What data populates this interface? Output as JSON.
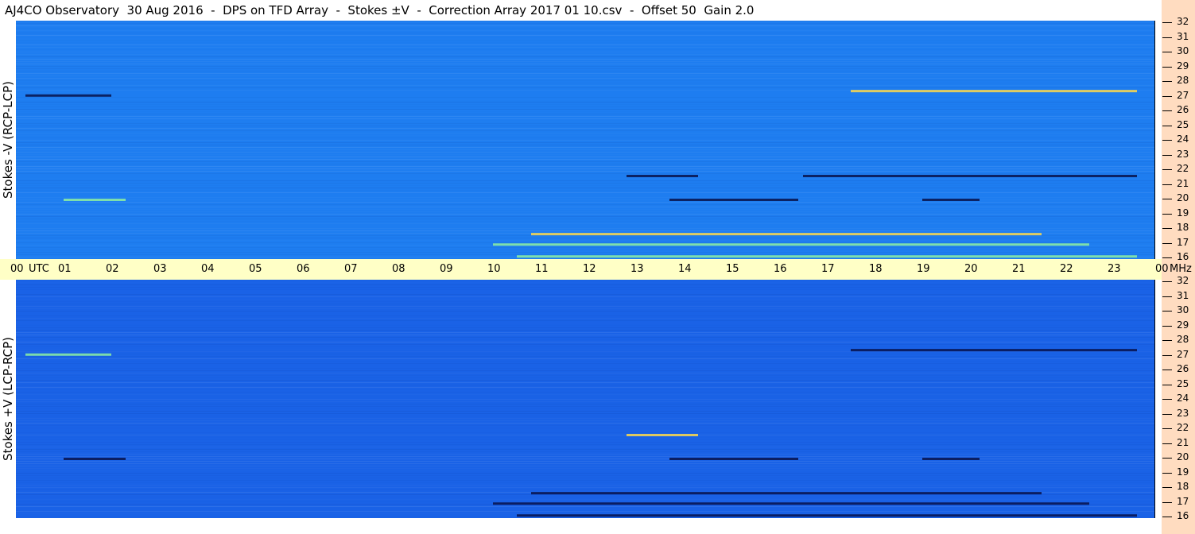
{
  "title": "AJ4CO Observatory  30 Aug 2016  -  DPS on TFD Array  -  Stokes ±V  -  Correction Array 2017 01 10.csv  -  Offset 50  Gain 2.0",
  "colors": {
    "top_background": "#1e7df0",
    "bottom_background": "#1a62e6",
    "axis_band": "#ffffc6",
    "freq_strip": "#ffdcc0",
    "hot": "#ffd94a",
    "warm": "#8ef0a0",
    "cold": "#08124a"
  },
  "chart_data": {
    "type": "heatmap",
    "x_unit": "UTC",
    "y_unit": "MHz",
    "x_ticks": [
      "00",
      "01",
      "02",
      "03",
      "04",
      "05",
      "06",
      "07",
      "08",
      "09",
      "10",
      "11",
      "12",
      "13",
      "14",
      "15",
      "16",
      "17",
      "18",
      "19",
      "20",
      "21",
      "22",
      "23",
      "00"
    ],
    "y_ticks": [
      "32",
      "31",
      "30",
      "29",
      "28",
      "27",
      "26",
      "25",
      "24",
      "23",
      "22",
      "21",
      "20",
      "19",
      "18",
      "17",
      "16"
    ],
    "xlim": [
      0,
      24
    ],
    "ylim": [
      16,
      32
    ],
    "panels": [
      {
        "label": "Stokes -V (RCP-LCP)",
        "features": [
          {
            "freq": 27.3,
            "start": 17.5,
            "end": 23.5,
            "intensity": "hot"
          },
          {
            "freq": 27.0,
            "start": 0.2,
            "end": 2.0,
            "intensity": "cold"
          },
          {
            "freq": 21.6,
            "start": 12.8,
            "end": 14.3,
            "intensity": "cold"
          },
          {
            "freq": 21.6,
            "start": 16.5,
            "end": 23.5,
            "intensity": "cold"
          },
          {
            "freq": 20.0,
            "start": 1.0,
            "end": 2.3,
            "intensity": "warm"
          },
          {
            "freq": 20.0,
            "start": 13.7,
            "end": 16.4,
            "intensity": "cold"
          },
          {
            "freq": 20.0,
            "start": 19.0,
            "end": 20.2,
            "intensity": "cold"
          },
          {
            "freq": 17.7,
            "start": 10.8,
            "end": 21.5,
            "intensity": "hot"
          },
          {
            "freq": 17.0,
            "start": 10.0,
            "end": 22.5,
            "intensity": "warm"
          },
          {
            "freq": 16.2,
            "start": 10.5,
            "end": 23.5,
            "intensity": "warm"
          }
        ]
      },
      {
        "label": "Stokes +V (LCP-RCP)",
        "features": [
          {
            "freq": 27.3,
            "start": 17.5,
            "end": 23.5,
            "intensity": "cold"
          },
          {
            "freq": 27.0,
            "start": 0.2,
            "end": 2.0,
            "intensity": "warm"
          },
          {
            "freq": 21.6,
            "start": 12.8,
            "end": 14.3,
            "intensity": "hot"
          },
          {
            "freq": 20.0,
            "start": 1.0,
            "end": 2.3,
            "intensity": "cold"
          },
          {
            "freq": 20.0,
            "start": 13.7,
            "end": 16.4,
            "intensity": "cold"
          },
          {
            "freq": 20.0,
            "start": 19.0,
            "end": 20.2,
            "intensity": "cold"
          },
          {
            "freq": 17.7,
            "start": 10.8,
            "end": 21.5,
            "intensity": "cold"
          },
          {
            "freq": 17.0,
            "start": 10.0,
            "end": 22.5,
            "intensity": "cold"
          },
          {
            "freq": 16.2,
            "start": 10.5,
            "end": 23.5,
            "intensity": "cold"
          }
        ]
      }
    ]
  }
}
